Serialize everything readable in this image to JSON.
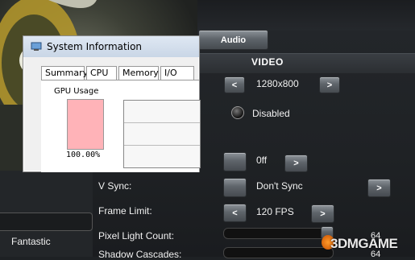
{
  "tabs_bar": {
    "audio_label": "Audio"
  },
  "video": {
    "header": "VIDEO",
    "resolution": {
      "value": "1280x800",
      "prev": "<",
      "next": ">"
    },
    "fullscreen": {
      "value": "Disabled"
    },
    "aa": {
      "value": "0ff",
      "next": ">"
    },
    "vsync": {
      "label": "V Sync:",
      "value": "Don't Sync",
      "next": ">"
    },
    "frame_limit": {
      "label": "Frame Limit:",
      "value": "120 FPS",
      "prev": "<",
      "next": ">"
    },
    "pixel_light": {
      "label": "Pixel Light Count:",
      "value": "64"
    },
    "shadow_cascades": {
      "label": "Shadow Cascades:",
      "value": "64"
    },
    "quality": {
      "value": "Fantastic"
    }
  },
  "dialog": {
    "title": "System Information",
    "tabs": [
      "Summary",
      "CPU",
      "Memory",
      "I/O"
    ],
    "gpu_label": "GPU Usage",
    "gpu_percent_text": "100.00%",
    "gpu_usage": 100
  },
  "watermark": {
    "text": "3DMGAME"
  },
  "colors": {
    "gpu_fill": "#ffb3b8",
    "button": "#6a7076",
    "background": "#1e2124"
  }
}
